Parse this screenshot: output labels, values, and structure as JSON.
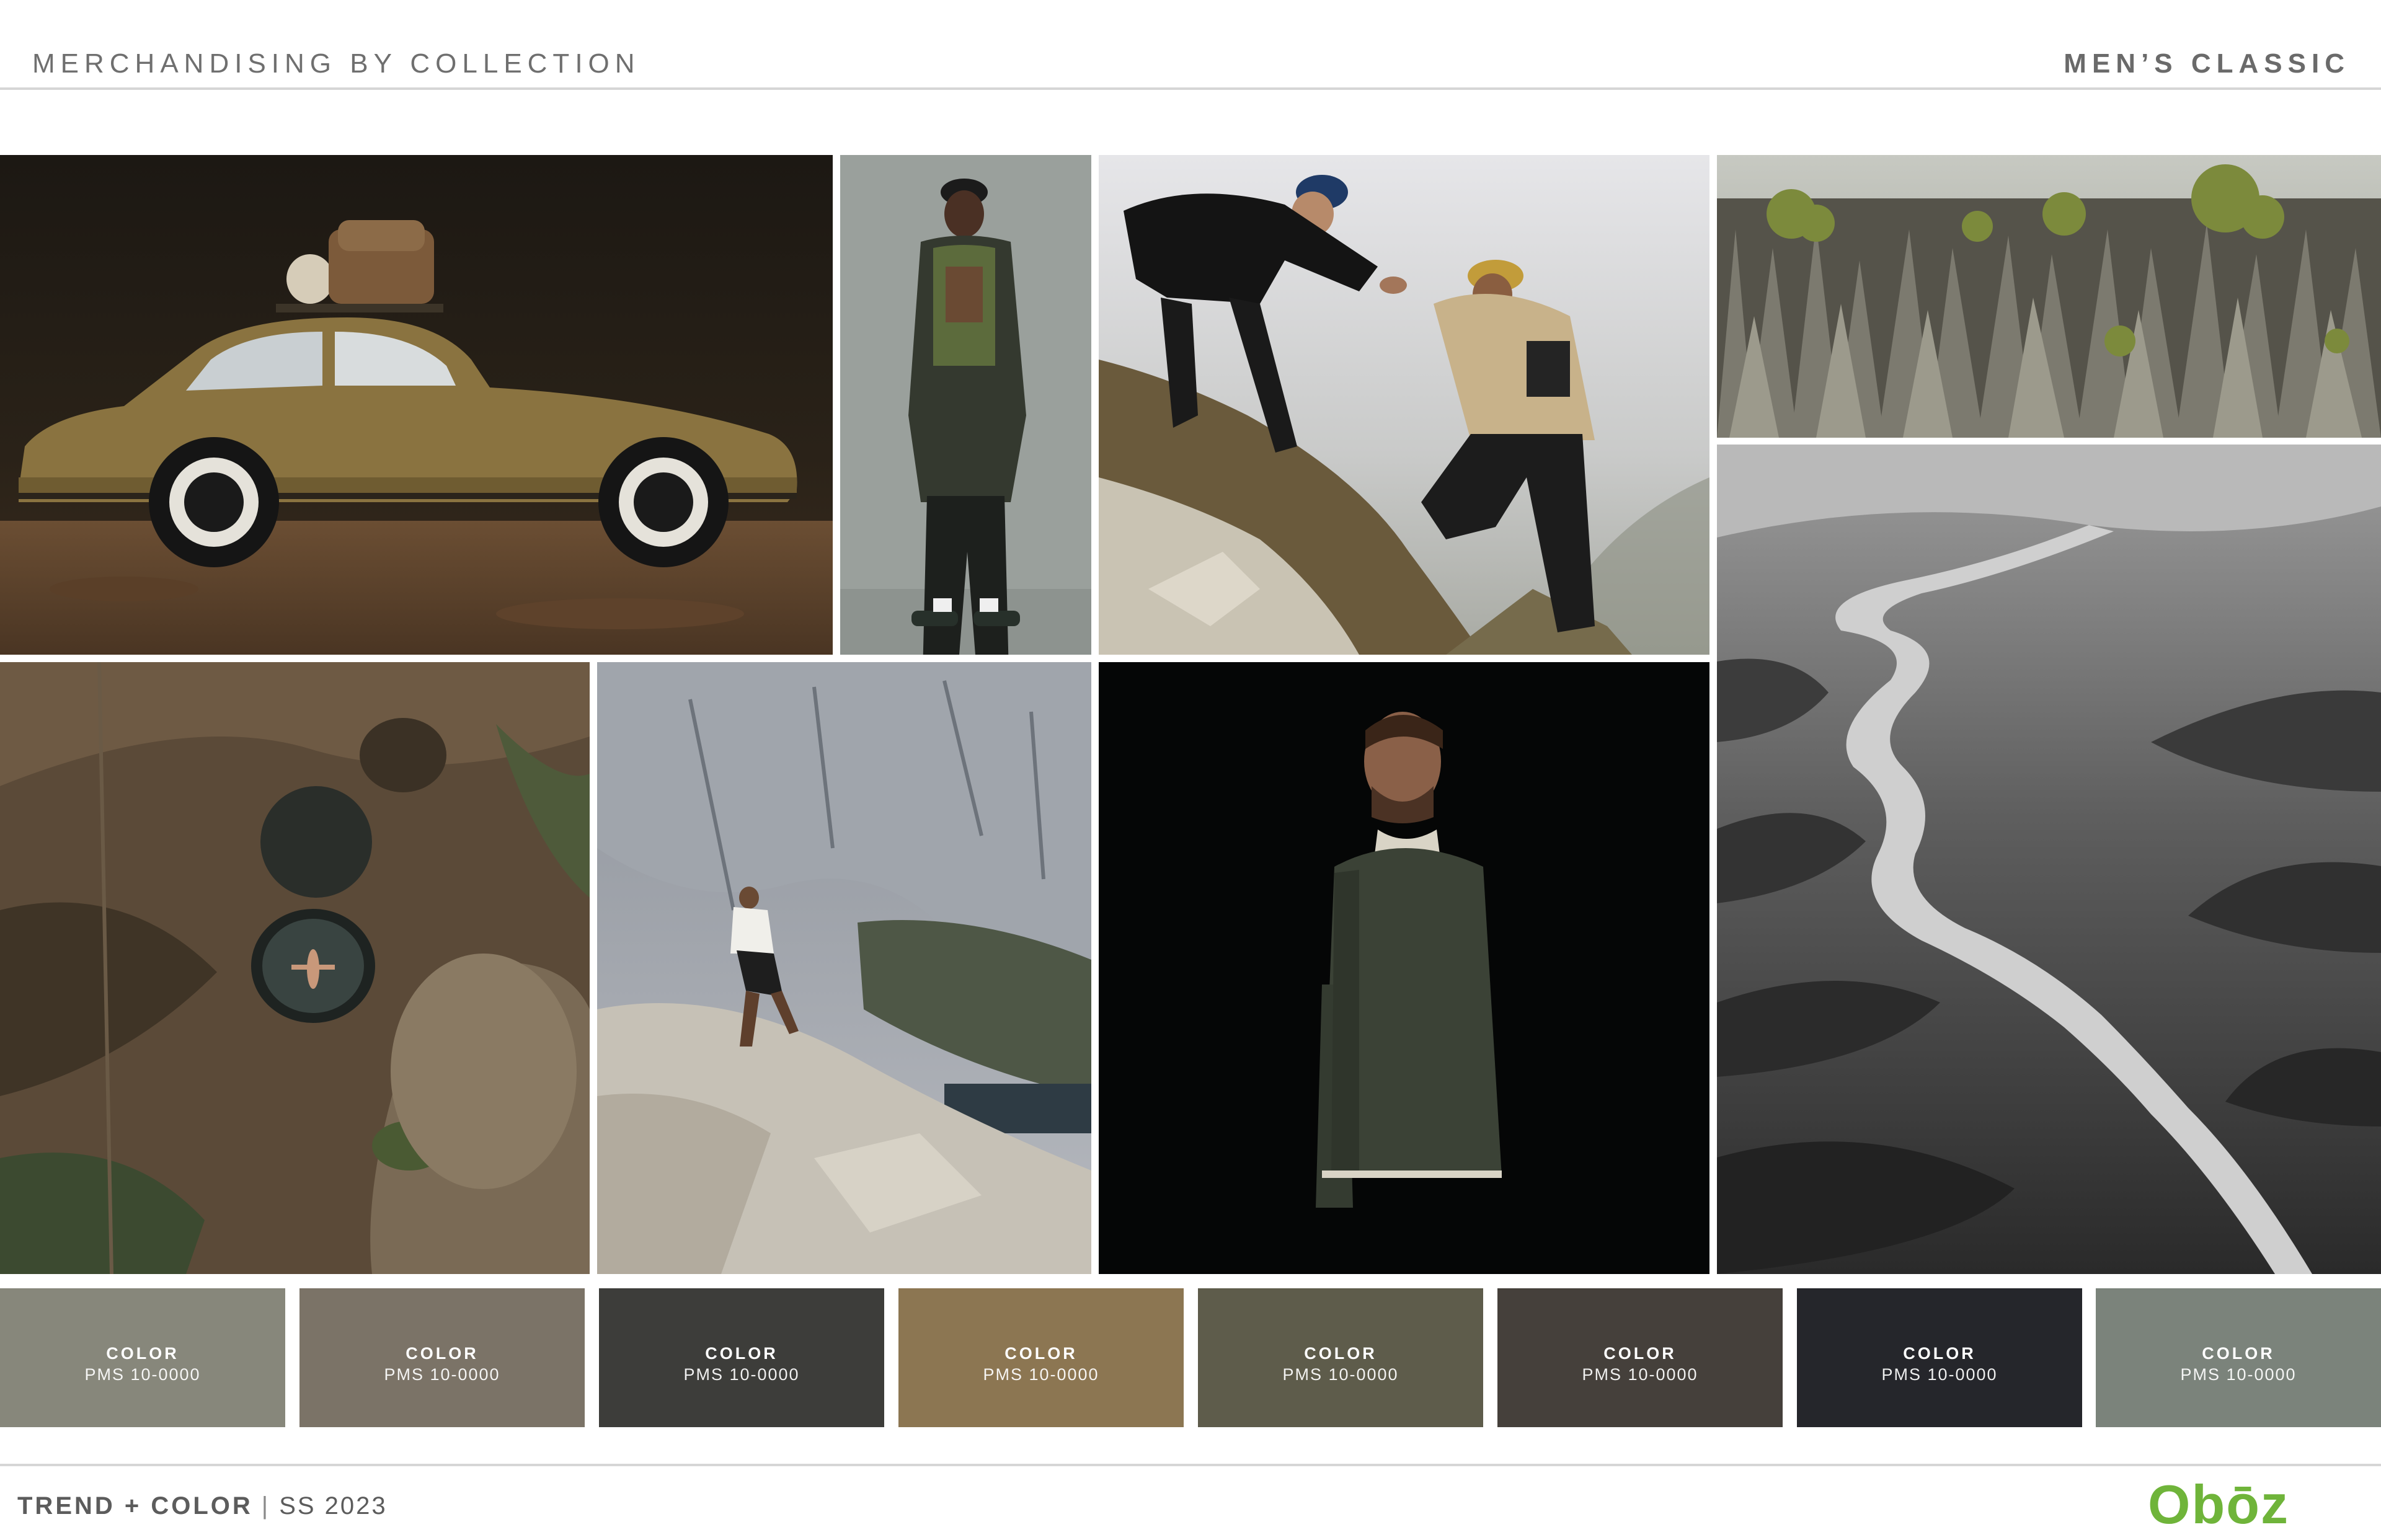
{
  "header": {
    "title": "MERCHANDISING BY COLLECTION",
    "collection": "MEN’S CLASSIC"
  },
  "photos": [
    {
      "subject": "car-photo"
    },
    {
      "subject": "model-jacket-photo"
    },
    {
      "subject": "climbers-photo"
    },
    {
      "subject": "stone-forest-photo"
    },
    {
      "subject": "aerial-river-photo"
    },
    {
      "subject": "aerial-pools-photo"
    },
    {
      "subject": "cliff-hiker-photo"
    },
    {
      "subject": "man-fleece-photo"
    }
  ],
  "swatches": [
    {
      "title": "COLOR",
      "code": "PMS 10-0000",
      "color": "#87877b"
    },
    {
      "title": "COLOR",
      "code": "PMS 10-0000",
      "color": "#7b7367"
    },
    {
      "title": "COLOR",
      "code": "PMS 10-0000",
      "color": "#3d3d3a"
    },
    {
      "title": "COLOR",
      "code": "PMS 10-0000",
      "color": "#8c7652"
    },
    {
      "title": "COLOR",
      "code": "PMS 10-0000",
      "color": "#5e5c4b"
    },
    {
      "title": "COLOR",
      "code": "PMS 10-0000",
      "color": "#45403b"
    },
    {
      "title": "COLOR",
      "code": "PMS 10-0000",
      "color": "#25262b"
    },
    {
      "title": "COLOR",
      "code": "PMS 10-0000",
      "color": "#7b837b"
    }
  ],
  "footer": {
    "label": "TREND + COLOR",
    "separator": "|",
    "season": "SS 2023"
  },
  "brand": {
    "logo_text": "Obōz",
    "color": "#6fb43a"
  }
}
